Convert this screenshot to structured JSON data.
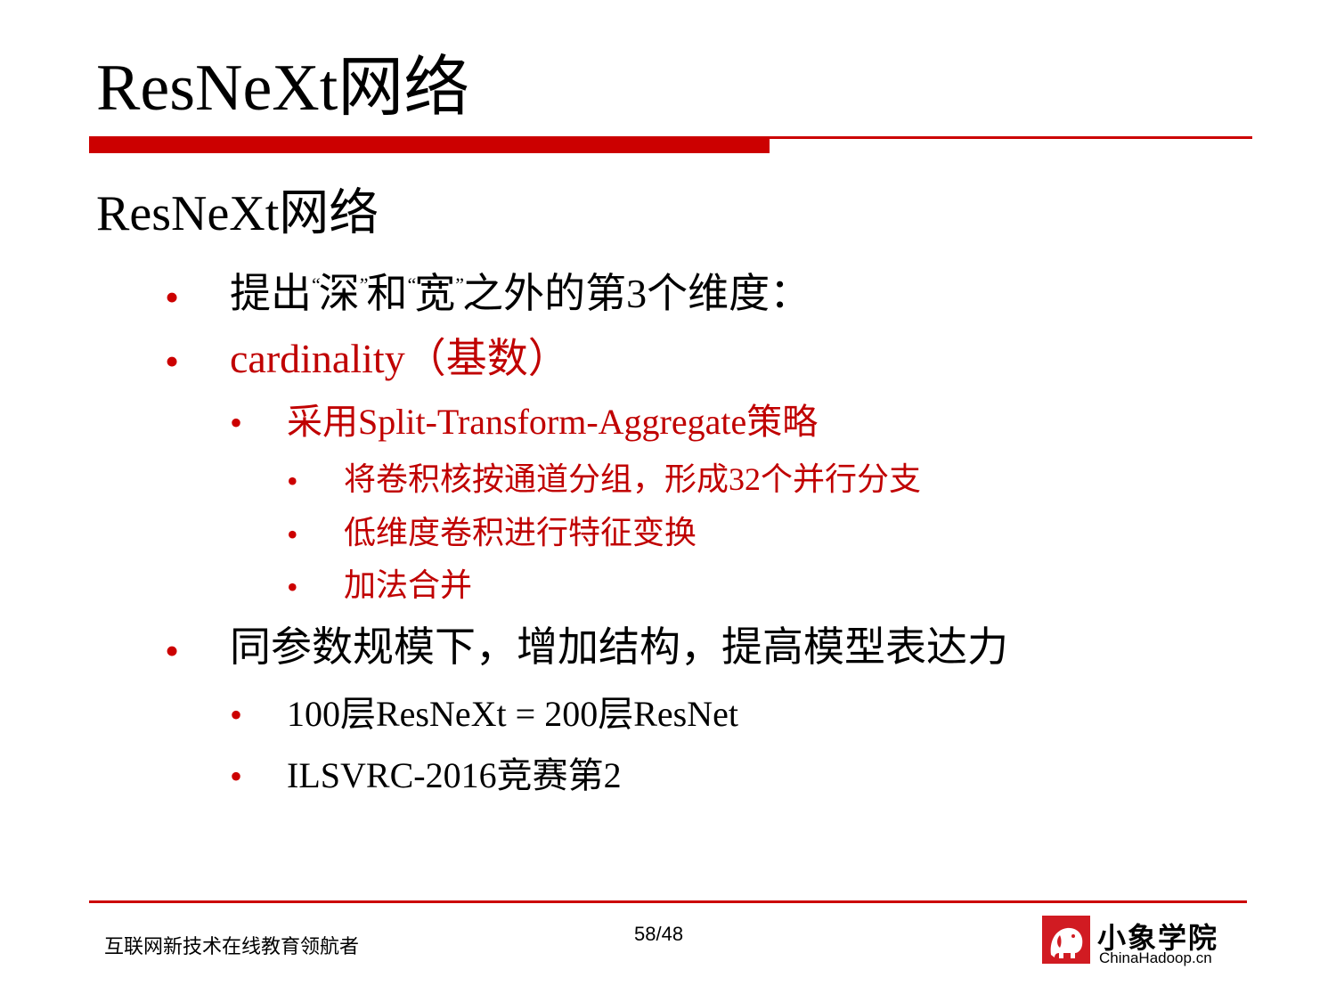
{
  "slide": {
    "title": "ResNeXt网络",
    "heading": "ResNeXt网络",
    "bullet_glyph": "•",
    "items": {
      "b1": {
        "pre": "提出",
        "q1": "“",
        "w1": "深",
        "q2": "”",
        "mid": "和",
        "q3": "“",
        "w2": "宽",
        "q4": "”",
        "post": "之外的第3个维度："
      },
      "b2": "cardinality（基数）",
      "b2_1": "采用Split-Transform-Aggregate策略",
      "b2_1_1": "将卷积核按通道分组，形成32个并行分支",
      "b2_1_2": "低维度卷积进行特征变换",
      "b2_1_3": "加法合并",
      "b3": "同参数规模下，增加结构，提高模型表达力",
      "b3_1": "100层ResNeXt = 200层ResNet",
      "b3_2": "ILSVRC-2016竞赛第2"
    },
    "accent_color": "#cc0000"
  },
  "footer": {
    "slogan": "互联网新技术在线教育领航者",
    "page": "58/48",
    "logo_cn": "小象学院",
    "logo_en": "ChinaHadoop.cn"
  }
}
